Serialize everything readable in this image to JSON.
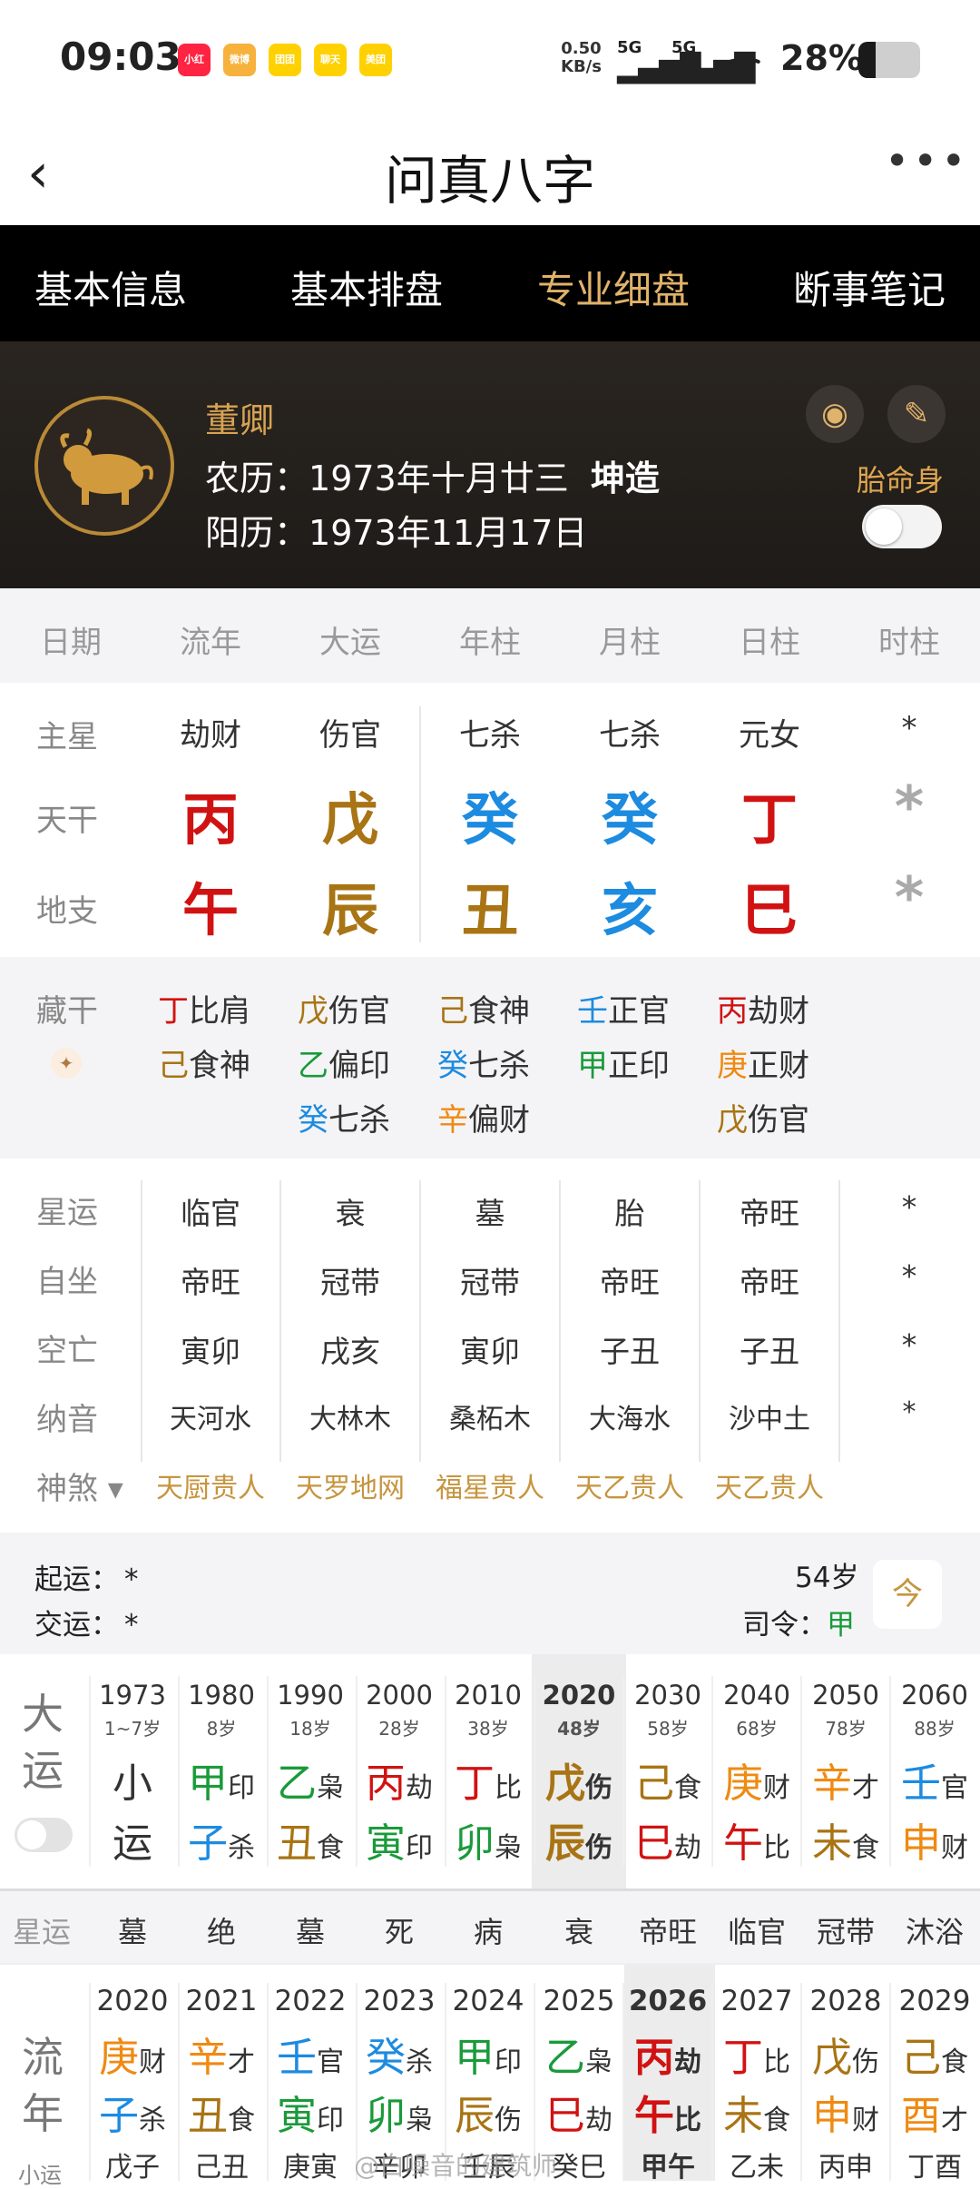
{
  "status": {
    "time": "09:03",
    "speed": "0.50\nKB/s",
    "net1": "5G",
    "net2": "5G",
    "battery": "28%",
    "battery_level": 0.28,
    "apps": [
      {
        "name": "小红书",
        "color": "#ff2442"
      },
      {
        "name": "微博",
        "color": "#f6b23c"
      },
      {
        "name": "团团",
        "color": "#ffd100"
      },
      {
        "name": "聊天",
        "color": "#ffd100"
      },
      {
        "name": "美团",
        "color": "#ffd100"
      }
    ]
  },
  "header": {
    "title": "问真八字"
  },
  "tabs": [
    "基本信息",
    "基本排盘",
    "专业细盘",
    "断事笔记"
  ],
  "profile": {
    "name": "董卿",
    "lunar_label": "农历：",
    "lunar": "1973年十月廿三",
    "gender": "坤造",
    "solar_label": "阳历：",
    "solar": "1973年11月17日",
    "taiming": "胎命身"
  },
  "pillar_headers": [
    "日期",
    "流年",
    "大运",
    "年柱",
    "月柱",
    "日柱",
    "时柱"
  ],
  "main_star": {
    "label": "主星",
    "values": [
      "劫财",
      "伤官",
      "七杀",
      "七杀",
      "元女",
      "*"
    ]
  },
  "tiangan": {
    "label": "天干",
    "values": [
      "丙",
      "戊",
      "癸",
      "癸",
      "丁",
      "*"
    ],
    "colors": [
      "#d11212",
      "#a87414",
      "#1c8be0",
      "#1c8be0",
      "#d11212",
      "#aaaaaa"
    ]
  },
  "dizhi": {
    "label": "地支",
    "values": [
      "午",
      "辰",
      "丑",
      "亥",
      "巳",
      "*"
    ],
    "colors": [
      "#d11212",
      "#a87414",
      "#a87414",
      "#1c8be0",
      "#d11212",
      "#aaaaaa"
    ]
  },
  "canggan": {
    "label": "藏干",
    "cols": [
      [
        {
          "g": "丁",
          "c": "#d11212",
          "t": "比肩"
        },
        {
          "g": "己",
          "c": "#a87414",
          "t": "食神"
        }
      ],
      [
        {
          "g": "戊",
          "c": "#a87414",
          "t": "伤官"
        },
        {
          "g": "乙",
          "c": "#1a9a3a",
          "t": "偏印"
        },
        {
          "g": "癸",
          "c": "#1c8be0",
          "t": "七杀"
        }
      ],
      [
        {
          "g": "己",
          "c": "#a87414",
          "t": "食神"
        },
        {
          "g": "癸",
          "c": "#1c8be0",
          "t": "七杀"
        },
        {
          "g": "辛",
          "c": "#ef8a12",
          "t": "偏财"
        }
      ],
      [
        {
          "g": "壬",
          "c": "#1c8be0",
          "t": "正官"
        },
        {
          "g": "甲",
          "c": "#1a9a3a",
          "t": "正印"
        }
      ],
      [
        {
          "g": "丙",
          "c": "#d11212",
          "t": "劫财"
        },
        {
          "g": "庚",
          "c": "#ef8a12",
          "t": "正财"
        },
        {
          "g": "戊",
          "c": "#a87414",
          "t": "伤官"
        }
      ]
    ]
  },
  "info_rows": [
    {
      "label": "星运",
      "values": [
        "临官",
        "衰",
        "墓",
        "胎",
        "帝旺",
        "*"
      ]
    },
    {
      "label": "自坐",
      "values": [
        "帝旺",
        "冠带",
        "冠带",
        "帝旺",
        "帝旺",
        "*"
      ]
    },
    {
      "label": "空亡",
      "values": [
        "寅卯",
        "戌亥",
        "寅卯",
        "子丑",
        "子丑",
        "*"
      ]
    },
    {
      "label": "纳音",
      "values": [
        "天河水",
        "大林木",
        "桑柘木",
        "大海水",
        "沙中土",
        "*"
      ]
    }
  ],
  "shensha": {
    "label": "神煞",
    "values": [
      "天厨贵人",
      "天罗地网",
      "福星贵人",
      "天乙贵人",
      "天乙贵人"
    ]
  },
  "qiyun": {
    "start_label": "起运：",
    "start": "*",
    "jiao_label": "交运：",
    "jiao": "*",
    "age": "54岁",
    "siling_label": "司令：",
    "siling": "甲",
    "cal_char": "今"
  },
  "dayun": {
    "title1": "大",
    "title2": "运",
    "small1": "小",
    "small2": "运",
    "items": [
      {
        "year": "1973",
        "age": "1~7岁",
        "g": "",
        "gc": "",
        "gt": "",
        "z": "",
        "zc": "",
        "zt": ""
      },
      {
        "year": "1980",
        "age": "8岁",
        "g": "甲",
        "gc": "#1a9a3a",
        "gt": "印",
        "z": "子",
        "zc": "#1c8be0",
        "zt": "杀"
      },
      {
        "year": "1990",
        "age": "18岁",
        "g": "乙",
        "gc": "#1a9a3a",
        "gt": "枭",
        "z": "丑",
        "zc": "#a87414",
        "zt": "食"
      },
      {
        "year": "2000",
        "age": "28岁",
        "g": "丙",
        "gc": "#d11212",
        "gt": "劫",
        "z": "寅",
        "zc": "#1a9a3a",
        "zt": "印"
      },
      {
        "year": "2010",
        "age": "38岁",
        "g": "丁",
        "gc": "#d11212",
        "gt": "比",
        "z": "卯",
        "zc": "#1a9a3a",
        "zt": "枭"
      },
      {
        "year": "2020",
        "age": "48岁",
        "g": "戊",
        "gc": "#a87414",
        "gt": "伤",
        "z": "辰",
        "zc": "#a87414",
        "zt": "伤"
      },
      {
        "year": "2030",
        "age": "58岁",
        "g": "己",
        "gc": "#a87414",
        "gt": "食",
        "z": "巳",
        "zc": "#d11212",
        "zt": "劫"
      },
      {
        "year": "2040",
        "age": "68岁",
        "g": "庚",
        "gc": "#ef8a12",
        "gt": "财",
        "z": "午",
        "zc": "#d11212",
        "zt": "比"
      },
      {
        "year": "2050",
        "age": "78岁",
        "g": "辛",
        "gc": "#ef8a12",
        "gt": "才",
        "z": "未",
        "zc": "#a87414",
        "zt": "食"
      },
      {
        "year": "2060",
        "age": "88岁",
        "g": "壬",
        "gc": "#1c8be0",
        "gt": "官",
        "z": "申",
        "zc": "#ef8a12",
        "zt": "财"
      }
    ]
  },
  "xingyun_row": {
    "label": "星运",
    "values": [
      "墓",
      "绝",
      "墓",
      "死",
      "病",
      "衰",
      "帝旺",
      "临官",
      "冠带",
      "沐浴"
    ]
  },
  "liunian": {
    "title1": "流",
    "title2": "年",
    "small": "小运",
    "items": [
      {
        "year": "2020",
        "g": "庚",
        "gc": "#ef8a12",
        "gt": "财",
        "z": "子",
        "zc": "#1c8be0",
        "zt": "杀",
        "x": "戊子"
      },
      {
        "year": "2021",
        "g": "辛",
        "gc": "#ef8a12",
        "gt": "才",
        "z": "丑",
        "zc": "#a87414",
        "zt": "食",
        "x": "己丑"
      },
      {
        "year": "2022",
        "g": "壬",
        "gc": "#1c8be0",
        "gt": "官",
        "z": "寅",
        "zc": "#1a9a3a",
        "zt": "印",
        "x": "庚寅"
      },
      {
        "year": "2023",
        "g": "癸",
        "gc": "#1c8be0",
        "gt": "杀",
        "z": "卯",
        "zc": "#1a9a3a",
        "zt": "枭",
        "x": "辛卯"
      },
      {
        "year": "2024",
        "g": "甲",
        "gc": "#1a9a3a",
        "gt": "印",
        "z": "辰",
        "zc": "#a87414",
        "zt": "伤",
        "x": "壬辰"
      },
      {
        "year": "2025",
        "g": "乙",
        "gc": "#1a9a3a",
        "gt": "枭",
        "z": "巳",
        "zc": "#d11212",
        "zt": "劫",
        "x": "癸巳"
      },
      {
        "year": "2026",
        "g": "丙",
        "gc": "#d11212",
        "gt": "劫",
        "z": "午",
        "zc": "#d11212",
        "zt": "比",
        "x": "甲午"
      },
      {
        "year": "2027",
        "g": "丁",
        "gc": "#d11212",
        "gt": "比",
        "z": "未",
        "zc": "#a87414",
        "zt": "食",
        "x": "乙未"
      },
      {
        "year": "2028",
        "g": "戊",
        "gc": "#a87414",
        "gt": "伤",
        "z": "申",
        "zc": "#ef8a12",
        "zt": "财",
        "x": "丙申"
      },
      {
        "year": "2029",
        "g": "己",
        "gc": "#a87414",
        "gt": "食",
        "z": "酉",
        "zc": "#ef8a12",
        "zt": "才",
        "x": "丁酉"
      }
    ]
  },
  "watermark": "@白噪音的建筑师"
}
